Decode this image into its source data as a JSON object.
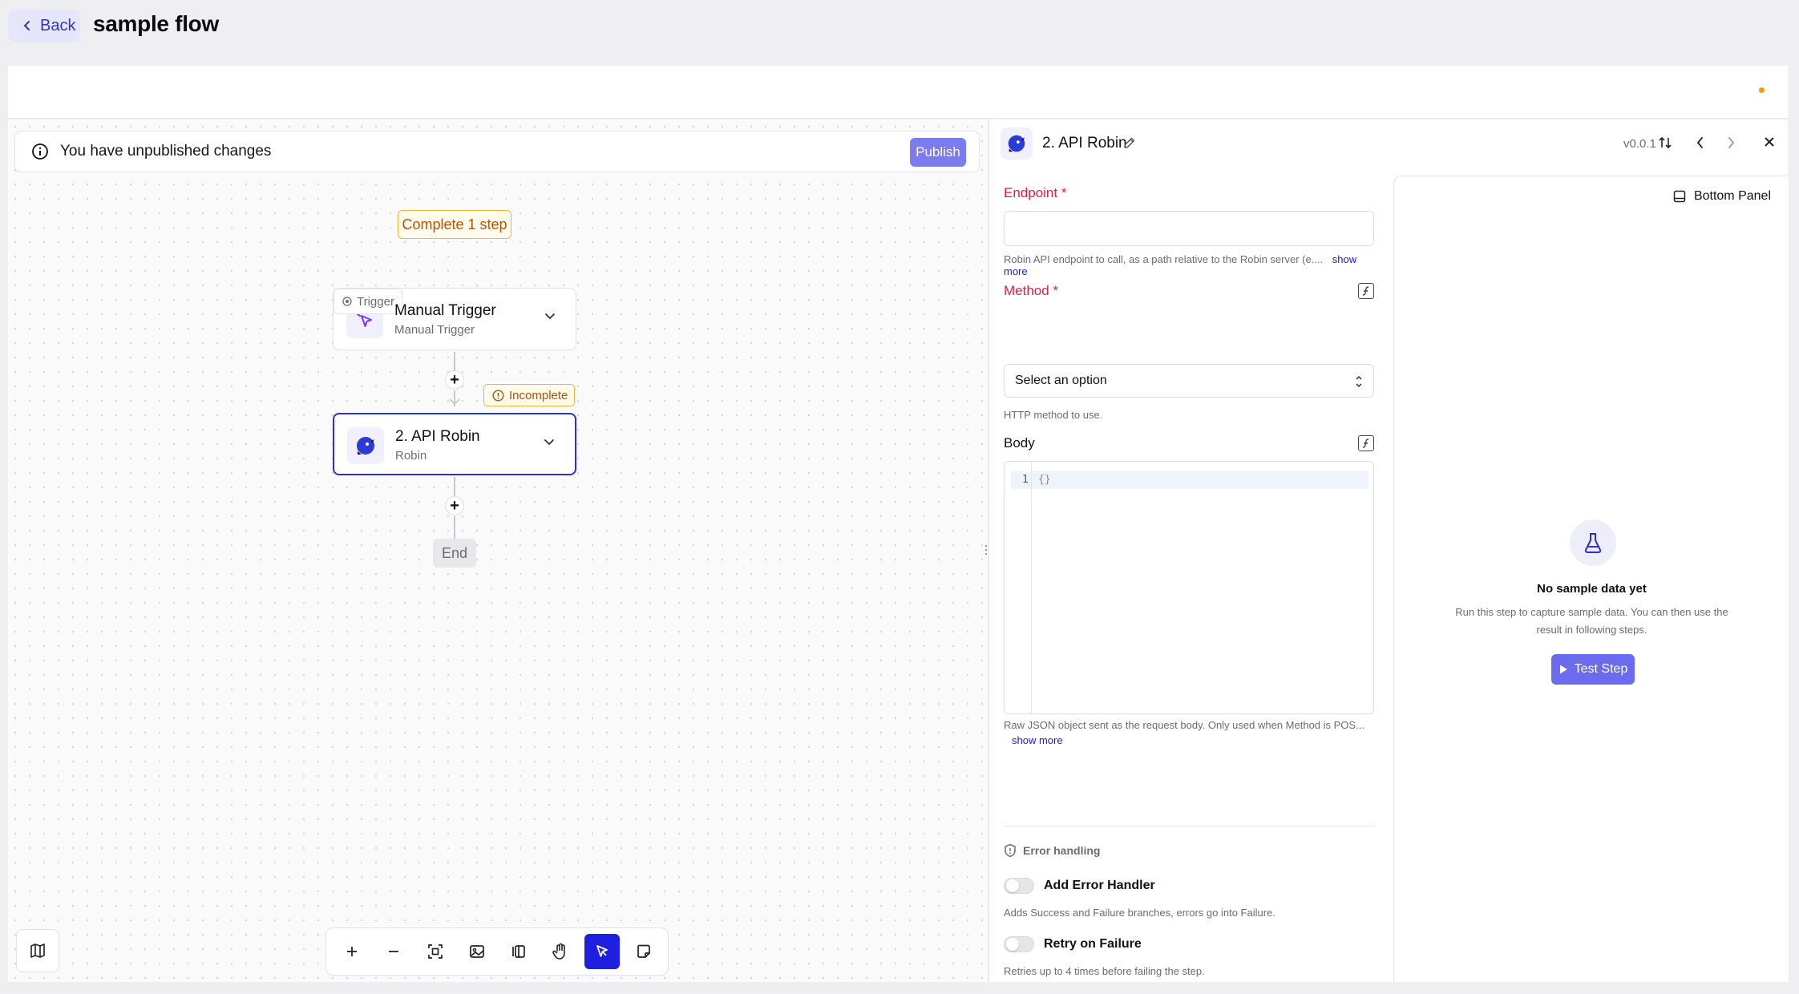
{
  "header": {
    "back_label": "Back",
    "title": "sample flow"
  },
  "banner": {
    "message": "You have unpublished changes",
    "publish_label": "Publish"
  },
  "canvas": {
    "complete_label": "Complete 1 step",
    "trigger_tag": "Trigger",
    "trigger_node": {
      "title": "Manual Trigger",
      "subtitle": "Manual Trigger"
    },
    "incomplete_label": "Incomplete",
    "step_node": {
      "title": "2. API Robin",
      "subtitle": "Robin"
    },
    "end_label": "End",
    "plus_symbol": "+"
  },
  "toolbar": {
    "tools": [
      "zoom-in",
      "zoom-out",
      "fit-view",
      "export-image",
      "toggle-panel",
      "pan-hand",
      "select-pointer",
      "note"
    ],
    "active_tool": "select-pointer"
  },
  "panel": {
    "step_title": "2. API Robin",
    "version": "v0.0.1",
    "endpoint_label": "Endpoint *",
    "endpoint_value": "",
    "endpoint_hint": "Robin API endpoint to call, as a path relative to the Robin server (e....",
    "show_more": "show more",
    "method_label": "Method *",
    "method_value": "Select an option",
    "method_hint": "HTTP method to use.",
    "body_label": "Body",
    "code_line_number": "1",
    "code_value": "{}",
    "body_hint": "Raw JSON object sent as the request body. Only used when Method is POS...",
    "error_handling_title": "Error handling",
    "add_error_handler_label": "Add Error Handler",
    "add_error_handler_hint": "Adds Success and Failure branches, errors go into Failure.",
    "add_error_handler_enabled": false,
    "retry_label": "Retry on Failure",
    "retry_hint": "Retries up to 4 times before failing the step.",
    "retry_enabled": false
  },
  "sample": {
    "bottom_panel_label": "Bottom Panel",
    "empty_title": "No sample data yet",
    "empty_desc": "Run this step to capture sample data. You can then use the result in following steps.",
    "test_step_label": "Test Step"
  },
  "colors": {
    "accent": "#1f1fe0",
    "warning": "#f1b33b",
    "publish": "#7c7cf0"
  }
}
